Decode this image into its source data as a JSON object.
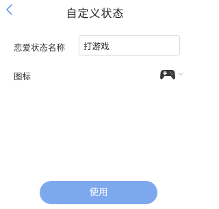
{
  "header": {
    "back_icon": "chevron-left-icon",
    "title": "自定义状态"
  },
  "form": {
    "name_label": "恋爱状态名称",
    "name_value": "打游戏",
    "icon_label": "图标",
    "selected_icon": "gamepad-icon"
  },
  "actions": {
    "use_label": "使用"
  },
  "colors": {
    "accent": "#7ea8ee",
    "back_icon": "#6b9ae8"
  }
}
